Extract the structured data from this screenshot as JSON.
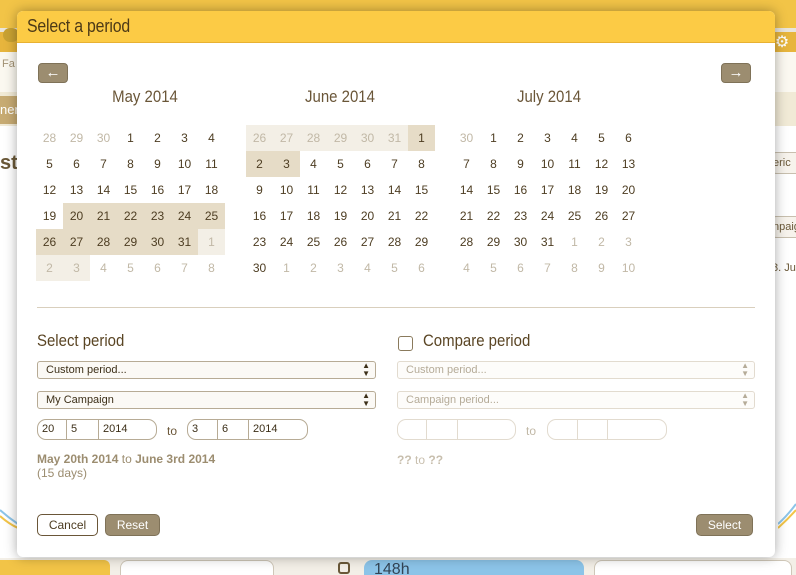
{
  "background": {
    "sub_text": "Fa",
    "left_text": "st",
    "tab_text": "ner",
    "right_pill_1": "eric",
    "right_pill_2": "npaig",
    "right_text": "8. Ju",
    "bottom_blue_text": "148h"
  },
  "modal": {
    "title": "Select a period",
    "prev_icon": "←",
    "next_icon": "→"
  },
  "calendars": [
    {
      "title": "May 2014",
      "weeks": [
        [
          "28",
          "29",
          "30",
          "1",
          "2",
          "3",
          "4"
        ],
        [
          "5",
          "6",
          "7",
          "8",
          "9",
          "10",
          "11"
        ],
        [
          "12",
          "13",
          "14",
          "15",
          "16",
          "17",
          "18"
        ],
        [
          "19",
          "20",
          "21",
          "22",
          "23",
          "24",
          "25"
        ],
        [
          "26",
          "27",
          "28",
          "29",
          "30",
          "31",
          "1"
        ],
        [
          "2",
          "3",
          "4",
          "5",
          "6",
          "7",
          "8"
        ]
      ]
    },
    {
      "title": "June 2014",
      "weeks": [
        [
          "26",
          "27",
          "28",
          "29",
          "30",
          "31",
          "1"
        ],
        [
          "2",
          "3",
          "4",
          "5",
          "6",
          "7",
          "8"
        ],
        [
          "9",
          "10",
          "11",
          "12",
          "13",
          "14",
          "15"
        ],
        [
          "16",
          "17",
          "18",
          "19",
          "20",
          "21",
          "22"
        ],
        [
          "23",
          "24",
          "25",
          "26",
          "27",
          "28",
          "29"
        ],
        [
          "30",
          "1",
          "2",
          "3",
          "4",
          "5",
          "6"
        ]
      ]
    },
    {
      "title": "July 2014",
      "weeks": [
        [
          "30",
          "1",
          "2",
          "3",
          "4",
          "5",
          "6"
        ],
        [
          "7",
          "8",
          "9",
          "10",
          "11",
          "12",
          "13"
        ],
        [
          "14",
          "15",
          "16",
          "17",
          "18",
          "19",
          "20"
        ],
        [
          "21",
          "22",
          "23",
          "24",
          "25",
          "26",
          "27"
        ],
        [
          "28",
          "29",
          "30",
          "31",
          "1",
          "2",
          "3"
        ],
        [
          "4",
          "5",
          "6",
          "7",
          "8",
          "9",
          "10"
        ]
      ]
    }
  ],
  "select_period": {
    "title": "Select period",
    "period_select": "Custom period...",
    "campaign_select": "My Campaign",
    "from": {
      "day": "20",
      "month": "5",
      "year": "2014"
    },
    "to_label": "to",
    "to": {
      "day": "3",
      "month": "6",
      "year": "2014"
    },
    "summary_start": "May 20th 2014",
    "summary_to": "to",
    "summary_end": "June 3rd 2014",
    "summary_days": "(15 days)"
  },
  "compare_period": {
    "title": "Compare period",
    "period_select": "Custom period...",
    "campaign_select": "Campaign period...",
    "to_label": "to",
    "summary_start": "??",
    "summary_to": "to",
    "summary_end": "??"
  },
  "buttons": {
    "cancel": "Cancel",
    "reset": "Reset",
    "select": "Select"
  },
  "colors": {
    "header": "#fccb45",
    "accent": "#9c8d70",
    "selection": "#e6dcc7"
  }
}
